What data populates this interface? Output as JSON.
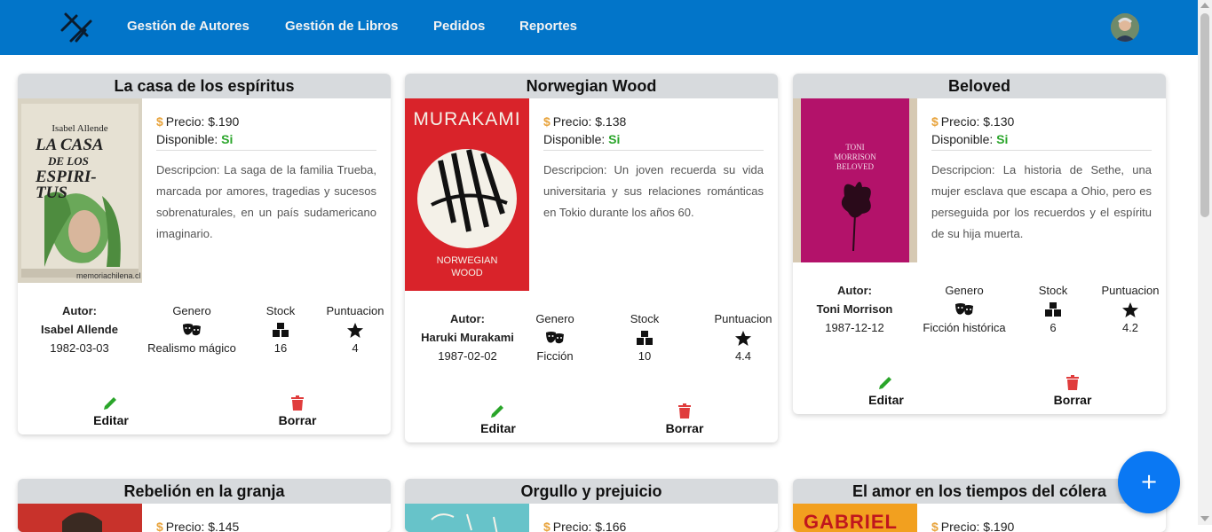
{
  "nav": {
    "links": [
      "Gestión de Autores",
      "Gestión de Libros",
      "Pedidos",
      "Reportes"
    ]
  },
  "labels": {
    "price_prefix": "Precio: $.",
    "available": "Disponible:",
    "author": "Autor:",
    "genre": "Genero",
    "stock": "Stock",
    "score": "Puntuacion",
    "edit": "Editar",
    "delete": "Borrar"
  },
  "books": [
    {
      "title": "La casa de los espíritus",
      "price": "Precio: $.190",
      "available": "Si",
      "description": "Descripcion: La saga de la familia Trueba, marcada por amores, tragedias y sucesos sobrenaturales, en un país sudamericano imaginario.",
      "author": "Isabel Allende",
      "birth": "1982-03-03",
      "genre": "Realismo mágico",
      "stock": "16",
      "score": "4",
      "cover_text": [
        "Isabel Allende",
        "LA CASA",
        "DE LOS",
        "ESPIRI-",
        "TUS",
        "memoriachilena.cl"
      ]
    },
    {
      "title": "Norwegian Wood",
      "price": "Precio: $.138",
      "available": "Si",
      "description": "Descripcion: Un joven recuerda su vida universitaria y sus relaciones románticas en Tokio durante los años 60.",
      "author": "Haruki Murakami",
      "birth": "1987-02-02",
      "genre": "Ficción",
      "stock": "10",
      "score": "4.4",
      "cover_text": [
        "MURAKAMI",
        "NORWEGIAN",
        "WOOD"
      ]
    },
    {
      "title": "Beloved",
      "price": "Precio: $.130",
      "available": "Si",
      "description": "Descripcion: La historia de Sethe, una mujer esclava que escapa a Ohio, pero es perseguida por los recuerdos y el espíritu de su hija muerta.",
      "author": "Toni Morrison",
      "birth": "1987-12-12",
      "genre": "Ficción histórica",
      "stock": "6",
      "score": "4.2",
      "cover_text": [
        "TONI",
        "MORRISON",
        "BELOVED"
      ]
    },
    {
      "title": "Rebelión en la granja",
      "price": "Precio: $.145"
    },
    {
      "title": "Orgullo y prejuicio",
      "price": "Precio: $.166"
    },
    {
      "title": "El amor en los tiempos del cólera",
      "price": "Precio: $.190",
      "cover_text": [
        "GABRIEL"
      ]
    }
  ],
  "fab": {
    "label": "+"
  },
  "colors": {
    "navbar": "#0275c9",
    "available": "#2aa52a",
    "edit": "#2aa52a",
    "delete": "#e03c3c",
    "fab": "#0a78f3",
    "dollar": "#e8a33b"
  }
}
